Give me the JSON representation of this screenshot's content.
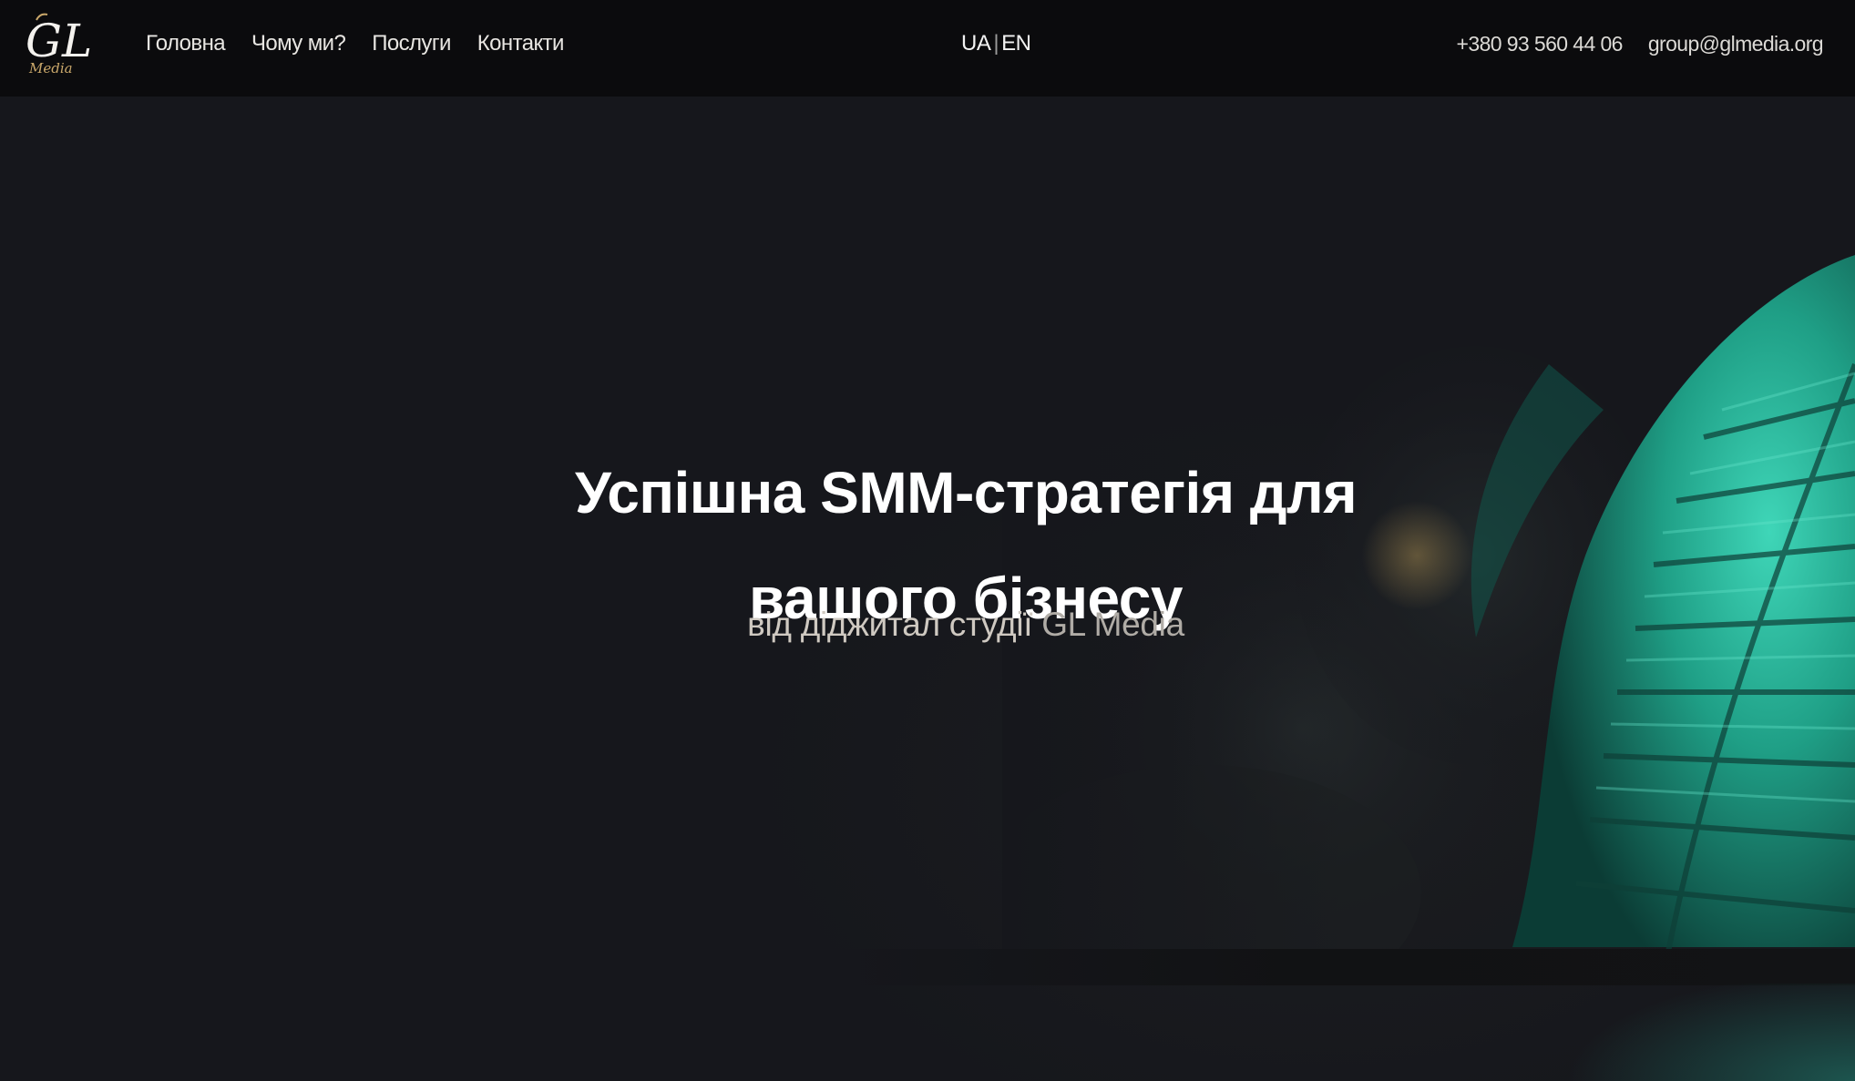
{
  "header": {
    "logo": {
      "letters": "GL",
      "script": "Media"
    },
    "nav": [
      {
        "label": "Головна"
      },
      {
        "label": "Чому ми?"
      },
      {
        "label": "Послуги"
      },
      {
        "label": "Контакти"
      }
    ],
    "lang": {
      "ua": "UA",
      "separator": "|",
      "en": "EN"
    },
    "phone": "+380 93 560 44 06",
    "email": "group@glmedia.org"
  },
  "hero": {
    "title_part1": "Успішна ",
    "title_smm": "SMM",
    "title_part2": "-стратегія для",
    "title_line2": "вашого бізнесу",
    "subtitle": "від діджитал студії ",
    "subtitle_brand": "GL Media"
  },
  "colors": {
    "background": "#16171c",
    "header": "#0b0b0d",
    "leaf_accent": "#2fbfa3"
  }
}
